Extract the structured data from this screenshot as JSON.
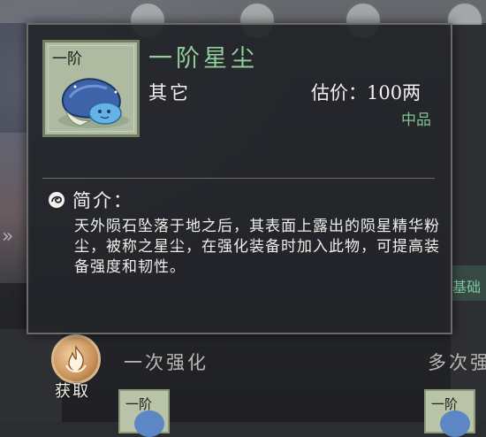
{
  "tooltip": {
    "item_tier_label": "一阶",
    "item_name": "一阶星尘",
    "category": "其它",
    "price_label": "估价：",
    "price_value": "100两",
    "grade": "中品",
    "intro_title": "简介：",
    "intro_text": "天外陨石坠落于地之后，其表面上露出的陨星精华粉尘，被称之星尘，在强化装备时加入此物，可提高装备强度和韧性。"
  },
  "bottom": {
    "acquire_label": "获取",
    "tab_once": "一次强化",
    "tab_multi": "多次强",
    "mini_card_tier": "一阶"
  },
  "background": {
    "right_label": "基础"
  },
  "icons": {
    "acquire": "flame-icon",
    "intro": "swirl-icon",
    "item": "blue-blob-stardust-icon"
  },
  "colors": {
    "item_name": "#8fcf9a",
    "grade": "#7ec38f",
    "panel_bg": "#24262a",
    "item_frame": "#aebba0"
  }
}
